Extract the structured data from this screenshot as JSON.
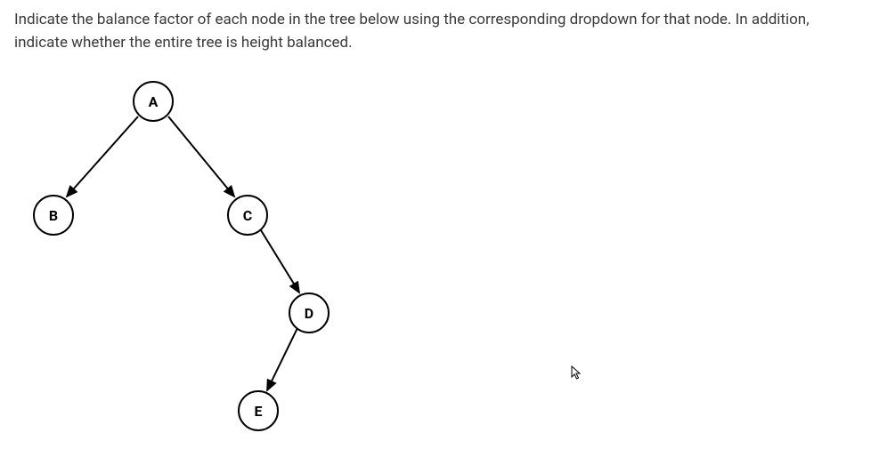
{
  "instructions": "Indicate the balance factor of each node in the tree below using the corresponding dropdown for that node. In addition, indicate whether the entire tree is height balanced.",
  "nodes": {
    "A": "A",
    "B": "B",
    "C": "C",
    "D": "D",
    "E": "E"
  }
}
